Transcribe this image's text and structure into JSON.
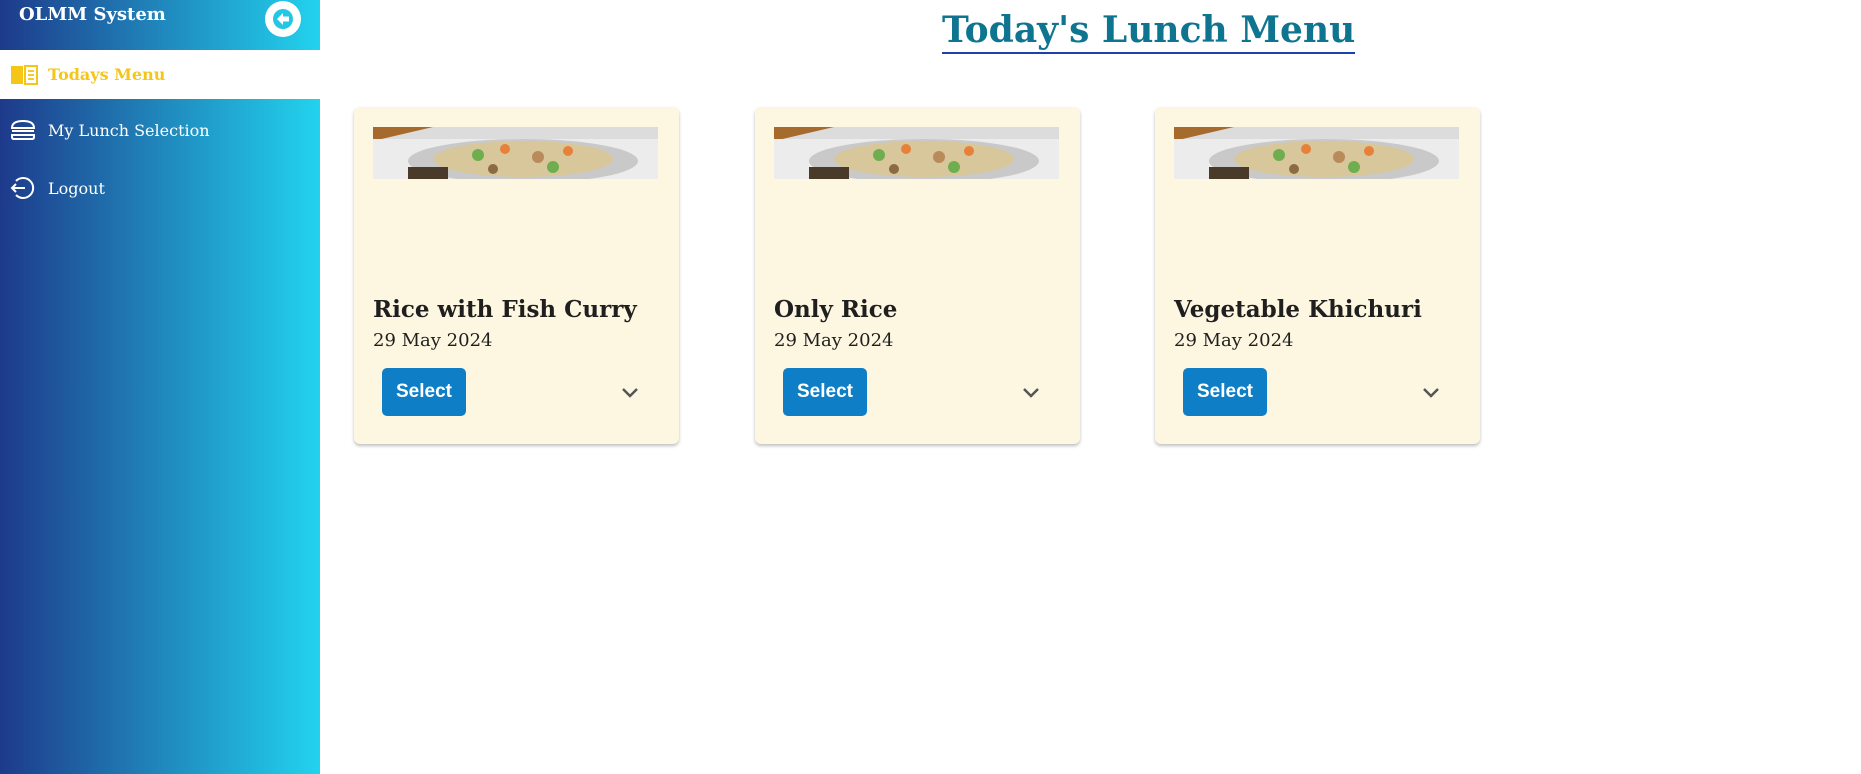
{
  "app": {
    "title": "OLMM System"
  },
  "sidebar": {
    "collapse_icon": "arrow-left-icon",
    "items": [
      {
        "label": "Todays Menu",
        "icon": "menu-book-icon",
        "active": true
      },
      {
        "label": "My Lunch Selection",
        "icon": "burger-icon",
        "active": false
      },
      {
        "label": "Logout",
        "icon": "logout-icon",
        "active": false
      }
    ]
  },
  "main": {
    "title": "Today's Lunch Menu",
    "cards": [
      {
        "name": "Rice with Fish Curry",
        "date": "29 May 2024",
        "button_label": "Select",
        "image": "food-image",
        "expand_icon": "chevron-down-icon"
      },
      {
        "name": "Only Rice",
        "date": "29 May 2024",
        "button_label": "Select",
        "image": "food-image",
        "expand_icon": "chevron-down-icon"
      },
      {
        "name": "Vegetable Khichuri",
        "date": "29 May 2024",
        "button_label": "Select",
        "image": "food-image",
        "expand_icon": "chevron-down-icon"
      }
    ]
  },
  "colors": {
    "sidebar_gradient_start": "#1e3a8a",
    "sidebar_gradient_end": "#22d3ee",
    "active_item": "#f5c518",
    "title": "#0e7490",
    "button": "#0e7fc7",
    "card_background": "#fdf6e0"
  }
}
